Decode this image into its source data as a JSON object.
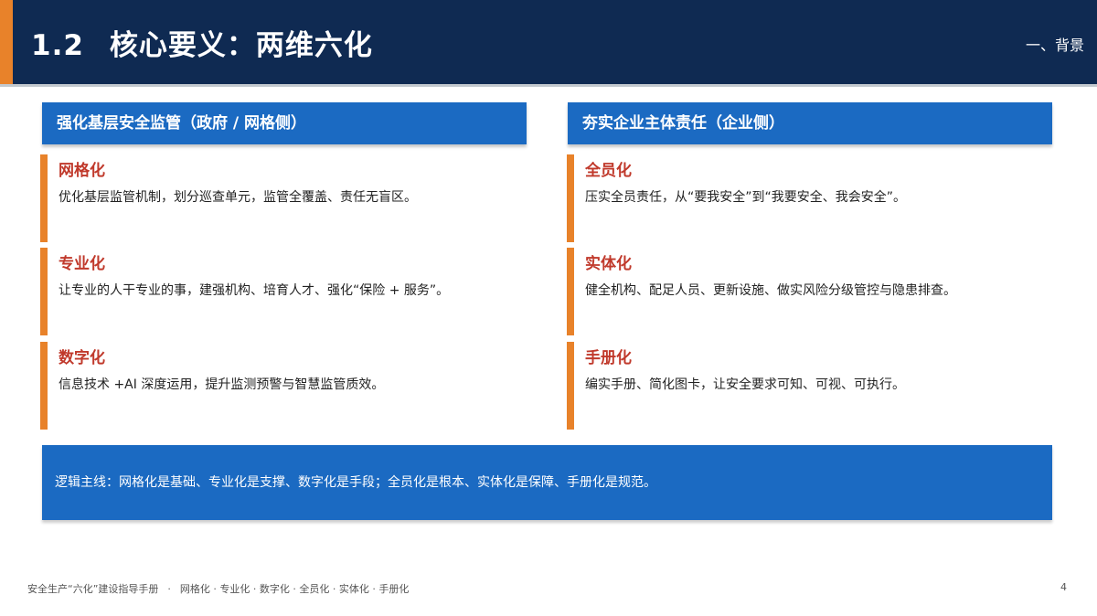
{
  "header": {
    "number": "1.2",
    "title": "核心要义：两维六化",
    "section": "一、背景"
  },
  "columns": [
    {
      "heading": "强化基层安全监管（政府 / 网格侧）",
      "items": [
        {
          "title": "网格化",
          "desc": "优化基层监管机制，划分巡查单元，监管全覆盖、责任无盲区。"
        },
        {
          "title": "专业化",
          "desc": "让专业的人干专业的事，建强机构、培育人才、强化“保险 + 服务”。"
        },
        {
          "title": "数字化",
          "desc": "信息技术 +AI 深度运用，提升监测预警与智慧监管质效。"
        }
      ]
    },
    {
      "heading": "夯实企业主体责任（企业侧）",
      "items": [
        {
          "title": "全员化",
          "desc": "压实全员责任，从“要我安全”到“我要安全、我会安全”。"
        },
        {
          "title": "实体化",
          "desc": "健全机构、配足人员、更新设施、做实风险分级管控与隐患排查。"
        },
        {
          "title": "手册化",
          "desc": "编实手册、简化图卡，让安全要求可知、可视、可执行。"
        }
      ]
    }
  ],
  "summary": "逻辑主线：网格化是基础、专业化是支撑、数字化是手段；全员化是根本、实体化是保障、手册化是规范。",
  "footer": {
    "doc": "安全生产“六化”建设指导手册",
    "dot": "·",
    "tags": "网格化 · 专业化 · 数字化 · 全员化 · 实体化 · 手册化",
    "page": "4"
  },
  "colors": {
    "header_bg": "#0f2a52",
    "accent_orange": "#e8822a",
    "blue": "#1b6ac2",
    "item_title_red": "#c0392b"
  }
}
